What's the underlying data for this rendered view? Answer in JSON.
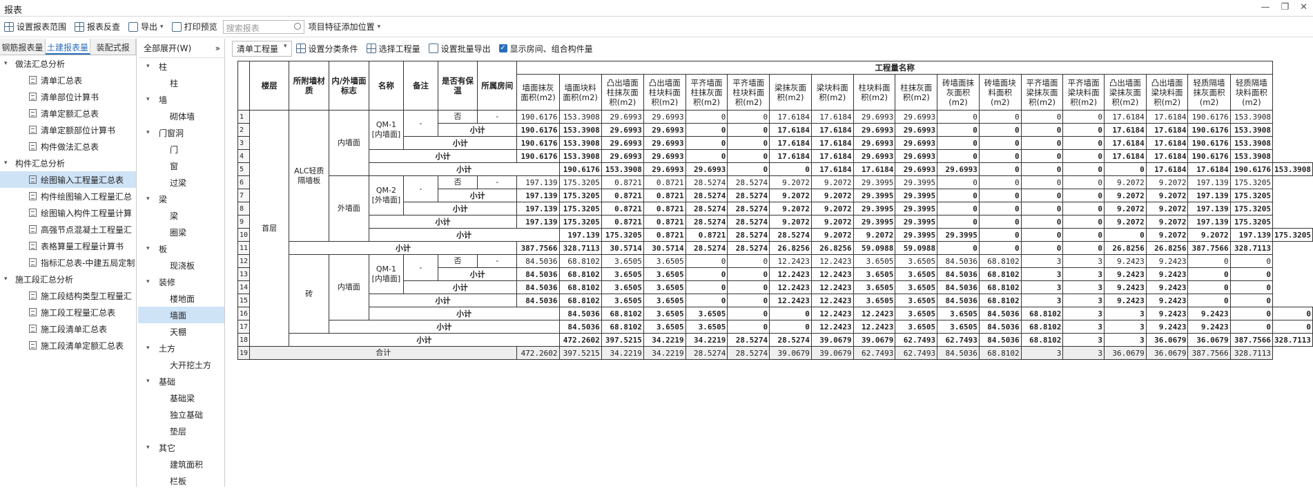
{
  "window": {
    "title": "报表"
  },
  "toolbar": {
    "range": "设置报表范围",
    "review": "报表反查",
    "export": "导出",
    "print": "打印预览",
    "search_placeholder": "搜索报表",
    "add_pos": "项目特征添加位置"
  },
  "tabs": [
    "钢筋报表量",
    "土建报表量",
    "装配式报"
  ],
  "tree": [
    {
      "label": "做法汇总分析",
      "items": [
        "清单汇总表",
        "清单部位计算书",
        "清单定额汇总表",
        "清单定额部位计算书",
        "构件做法汇总表"
      ]
    },
    {
      "label": "构件汇总分析",
      "items": [
        "绘图输入工程量汇总表",
        "构件绘图输入工程量汇总",
        "绘图输入构件工程量计算",
        "高强节点混凝土工程量汇",
        "表格算量工程量计算书",
        "指标汇总表-中建五局定制"
      ]
    },
    {
      "label": "施工段汇总分析",
      "items": [
        "施工段结构类型工程量汇",
        "施工段工程量汇总表",
        "施工段清单汇总表",
        "施工段清单定额汇总表"
      ]
    }
  ],
  "mid": {
    "expand": "全部展开(W)",
    "groups": [
      {
        "label": "柱",
        "items": [
          "柱"
        ]
      },
      {
        "label": "墙",
        "items": [
          "砌体墙"
        ]
      },
      {
        "label": "门窗洞",
        "items": [
          "门",
          "窗",
          "过梁"
        ]
      },
      {
        "label": "梁",
        "items": [
          "梁",
          "圈梁"
        ]
      },
      {
        "label": "板",
        "items": [
          "现浇板"
        ]
      },
      {
        "label": "装修",
        "items": [
          "楼地面",
          "墙面",
          "天棚"
        ]
      },
      {
        "label": "土方",
        "items": [
          "大开挖土方"
        ]
      },
      {
        "label": "基础",
        "items": [
          "基础梁",
          "独立基础",
          "垫层"
        ]
      },
      {
        "label": "其它",
        "items": [
          "建筑面积",
          "栏板"
        ]
      }
    ]
  },
  "rtool": {
    "mode": "清单工程量",
    "cls": "设置分类条件",
    "sel": "选择工程量",
    "batch": "设置批量导出",
    "show": "显示房间、组合构件量"
  },
  "table": {
    "h_floor": "楼层",
    "h_mat": "所附墙材质",
    "h_io": "内/外墙面标志",
    "h_name": "名称",
    "h_note": "备注",
    "h_ins": "是否有保温",
    "h_room": "所属房间",
    "h_group": "工程量名称",
    "cols": [
      "墙面抹灰面积(m2)",
      "墙面块料面积(m2)",
      "凸出墙面柱抹灰面积(m2)",
      "凸出墙面柱块料面积(m2)",
      "平齐墙面柱抹灰面积(m2)",
      "平齐墙面柱块料面积(m2)",
      "梁抹灰面积(m2)",
      "梁块料面积(m2)",
      "柱块料面积(m2)",
      "柱抹灰面积(m2)",
      "砖墙面抹灰面积(m2)",
      "砖墙面块料面积(m2)",
      "平齐墙面梁抹灰面积(m2)",
      "平齐墙面梁块料面积(m2)",
      "凸出墙面梁抹灰面积(m2)",
      "凸出墙面梁块料面积(m2)",
      "轻质隔墙抹灰面积(m2)",
      "轻质隔墙块料面积(m2)"
    ],
    "floor": "首层",
    "mat1": "ALC轻质隔墙板",
    "mat2": "砖",
    "inner": "内墙面",
    "outer": "外墙面",
    "qm1": "QM-1 [内墙面]",
    "qm2": "QM-2 [外墙面]",
    "dash": "-",
    "no": "否",
    "sub": "小计",
    "total": "合计",
    "rows": {
      "A": [
        "190.6176",
        "153.3908",
        "29.6993",
        "29.6993",
        "0",
        "0",
        "17.6184",
        "17.6184",
        "29.6993",
        "29.6993",
        "0",
        "0",
        "0",
        "0",
        "17.6184",
        "17.6184",
        "190.6176",
        "153.3908"
      ],
      "B": [
        "197.139",
        "175.3205",
        "0.8721",
        "0.8721",
        "28.5274",
        "28.5274",
        "9.2072",
        "9.2072",
        "29.3995",
        "29.3995",
        "0",
        "0",
        "0",
        "0",
        "9.2072",
        "9.2072",
        "197.139",
        "175.3205"
      ],
      "C": [
        "387.7566",
        "328.7113",
        "30.5714",
        "30.5714",
        "28.5274",
        "28.5274",
        "26.8256",
        "26.8256",
        "59.0988",
        "59.0988",
        "0",
        "0",
        "0",
        "0",
        "26.8256",
        "26.8256",
        "387.7566",
        "328.7113"
      ],
      "D": [
        "84.5036",
        "68.8102",
        "3.6505",
        "3.6505",
        "0",
        "0",
        "12.2423",
        "12.2423",
        "3.6505",
        "3.6505",
        "84.5036",
        "68.8102",
        "3",
        "3",
        "9.2423",
        "9.2423",
        "0",
        "0"
      ],
      "E": [
        "472.2602",
        "397.5215",
        "34.2219",
        "34.2219",
        "28.5274",
        "28.5274",
        "39.0679",
        "39.0679",
        "62.7493",
        "62.7493",
        "84.5036",
        "68.8102",
        "3",
        "3",
        "36.0679",
        "36.0679",
        "387.7566",
        "328.7113"
      ]
    },
    "rownums": [
      "1",
      "2",
      "3",
      "4",
      "5",
      "6",
      "7",
      "8",
      "9",
      "10",
      "11",
      "12",
      "13",
      "14",
      "15",
      "16",
      "17",
      "18",
      "19"
    ]
  }
}
